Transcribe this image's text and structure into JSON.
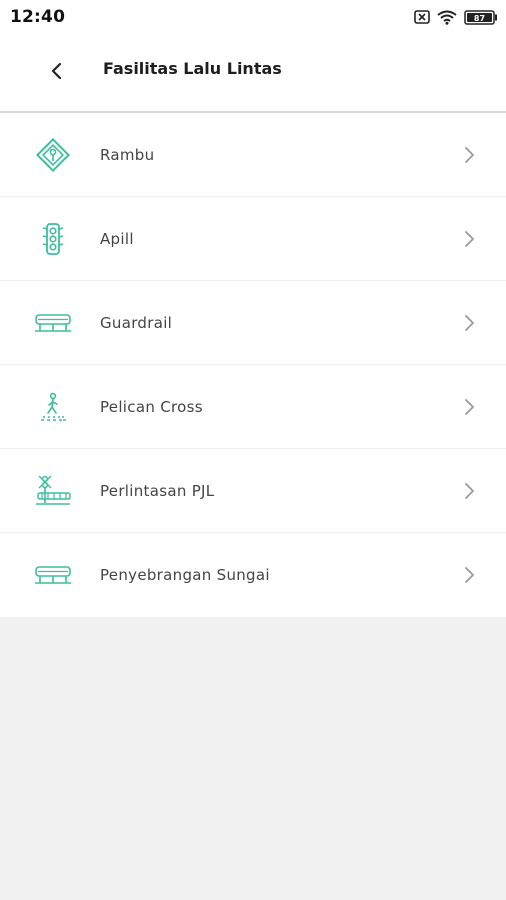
{
  "status_bar": {
    "time": "12:40",
    "battery": "87"
  },
  "header": {
    "title": "Fasilitas Lalu Lintas"
  },
  "accent_color": "#3cbf9c",
  "items": [
    {
      "label": "Rambu",
      "icon": "traffic-sign-icon"
    },
    {
      "label": "Apill",
      "icon": "traffic-light-icon"
    },
    {
      "label": "Guardrail",
      "icon": "guardrail-icon"
    },
    {
      "label": "Pelican Cross",
      "icon": "pedestrian-crossing-icon"
    },
    {
      "label": "Perlintasan PJL",
      "icon": "railway-crossing-icon"
    },
    {
      "label": "Penyebrangan Sungai",
      "icon": "river-crossing-icon"
    }
  ]
}
